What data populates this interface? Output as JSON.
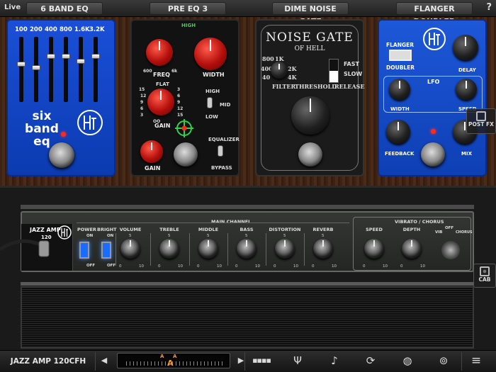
{
  "topbar": {
    "live_label": "Live",
    "slot1": "6 BAND EQ",
    "slot2": "PRE EQ 3",
    "slot3": "DIME NOISE GATE",
    "slot4": "FLANGER DOUBLER",
    "help": "?"
  },
  "eq6": {
    "bands": [
      "100",
      "200",
      "400",
      "800",
      "1.6K",
      "3.2K"
    ],
    "levels": [
      0.42,
      0.48,
      0.3,
      0.3,
      0.38,
      0.3
    ],
    "name_line1": "six band",
    "name_line2": "eq"
  },
  "preeq": {
    "high": "HIGH",
    "freq": "FREQ",
    "width": "WIDTH",
    "flat": "FLAT",
    "gain": "GAIN",
    "gain2": "GAIN",
    "switch_high": "HIGH",
    "switch_mid": "MID",
    "switch_low": "LOW",
    "equalizer": "EQUALIZER",
    "bypass": "BYPASS",
    "scale_low": "600",
    "scale_high": "6k",
    "scale_oo": "OO",
    "scale_left": [
      "15",
      "12",
      "9",
      "6",
      "3"
    ],
    "scale_right": [
      "3",
      "6",
      "9",
      "12",
      "15"
    ]
  },
  "gate": {
    "title_line1": "NOISE GATE",
    "title_line2": "OF HELL",
    "freqs": [
      "1K",
      "800",
      "2K",
      "400",
      "4K",
      "40"
    ],
    "filter": "FILTER",
    "threshold": "THRESHOLD",
    "release": "RELEASE",
    "fast": "FAST",
    "slow": "SLOW"
  },
  "flanger": {
    "flanger": "FLANGER",
    "doubler": "DOUBLER",
    "delay": "DELAY",
    "lfo": "LFO",
    "width": "WIDTH",
    "speed": "SPEED",
    "feedback": "FEEDBACK",
    "mix": "MIX",
    "post_fx": "POST FX"
  },
  "amp": {
    "name": "JAZZ AMP",
    "name_sub": "120",
    "main_channel": "MAIN CHANNEL",
    "vibrato": "VIBRATO / CHORUS",
    "power": "POWER",
    "bright": "BRIGHT",
    "on": "ON",
    "off": "OFF",
    "knobs": [
      "VOLUME",
      "TREBLE",
      "MIDDLE",
      "BASS",
      "DISTORTION",
      "REVERB"
    ],
    "vib_knobs": [
      "SPEED",
      "DEPTH"
    ],
    "vib_switch": [
      "VIB",
      "OFF",
      "CHORUS"
    ],
    "scale_min": "0",
    "scale_mid": "5",
    "scale_max": "10",
    "cab": "CAB"
  },
  "bottombar": {
    "preset": "JAZZ AMP 120CFH",
    "tuner_marks": [
      "A",
      "A"
    ],
    "tuner_note": "A"
  }
}
